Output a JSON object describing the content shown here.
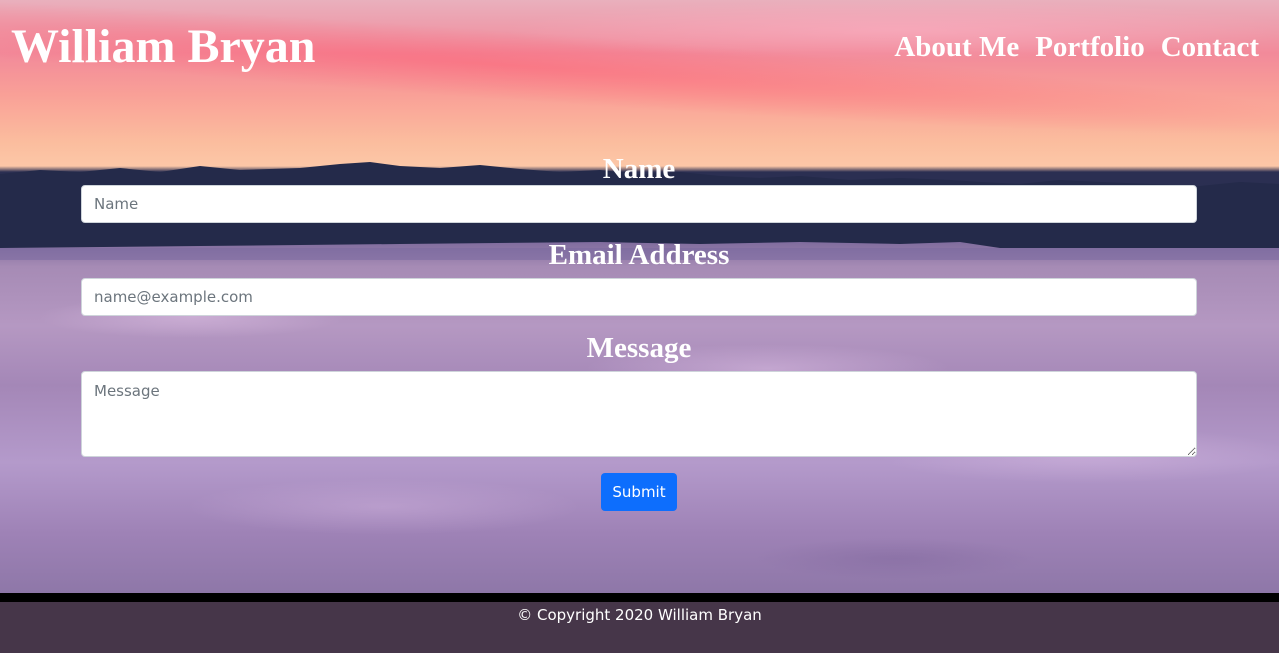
{
  "header": {
    "brand": "William Bryan",
    "nav": [
      "About Me",
      "Portfolio",
      "Contact"
    ]
  },
  "form": {
    "name_label": "Name",
    "name_placeholder": "Name",
    "email_label": "Email Address",
    "email_placeholder": "name@example.com",
    "message_label": "Message",
    "message_placeholder": "Message",
    "submit_label": "Submit"
  },
  "footer": {
    "copyright": "© Copyright 2020 William Bryan"
  },
  "colors": {
    "button": "#0d6efd",
    "footer_bg": "#463649"
  }
}
